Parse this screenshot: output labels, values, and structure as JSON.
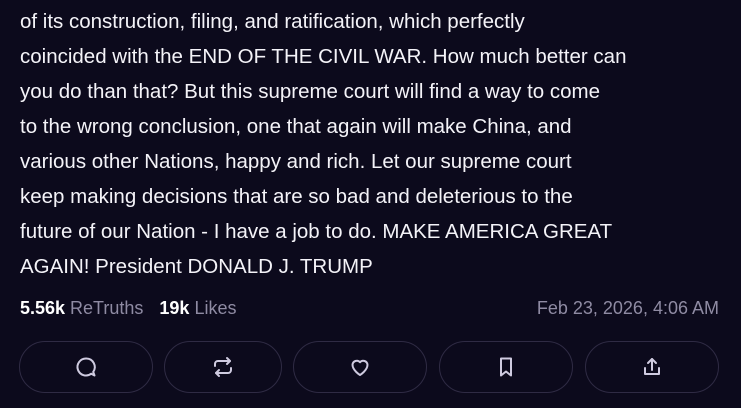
{
  "post": {
    "lines": [
      "of its construction, filing, and ratification, which perfectly",
      "coincided with the END OF THE CIVIL WAR. How much better can",
      "you do than that? But this supreme court will find a way to come",
      "to the wrong conclusion, one that again will make China, and",
      "various other Nations, happy and rich. Let our supreme court",
      "keep making decisions that are so bad and deleterious to the",
      "future of our Nation - I have a job to do. MAKE AMERICA GREAT",
      "AGAIN! President DONALD J. TRUMP"
    ]
  },
  "stats": {
    "retruths_count": "5.56k",
    "retruths_label": "ReTruths",
    "likes_count": "19k",
    "likes_label": "Likes",
    "timestamp": "Feb 23, 2026, 4:06 AM"
  },
  "actions": [
    {
      "name": "reply",
      "icon": "reply-icon"
    },
    {
      "name": "retruth",
      "icon": "retruth-icon"
    },
    {
      "name": "like",
      "icon": "heart-icon"
    },
    {
      "name": "bookmark",
      "icon": "bookmark-icon"
    },
    {
      "name": "share",
      "icon": "share-icon"
    }
  ],
  "colors": {
    "background": "#0c0a1c",
    "text": "#f4f3f8",
    "muted": "#8f8ba3",
    "button_border": "#2f2b44"
  }
}
